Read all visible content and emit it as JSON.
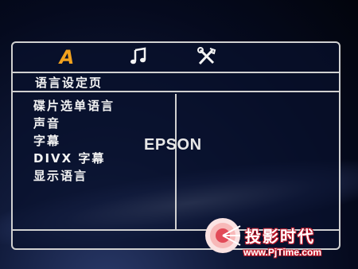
{
  "tabs": [
    {
      "label": "A",
      "icon": "language-icon"
    },
    {
      "icon": "music-note-icon"
    },
    {
      "icon": "tools-icon"
    }
  ],
  "page_title": "语言设定页",
  "menu": {
    "items": [
      {
        "label": "碟片选单语言"
      },
      {
        "label": "声音"
      },
      {
        "label": "字幕"
      },
      {
        "label": "DIVX 字幕"
      },
      {
        "label": "显示语言"
      }
    ]
  },
  "brand": "EPSON",
  "watermark": {
    "name": "投影时代",
    "url": "www.PjTime.com"
  },
  "colors": {
    "accent": "#f2a21e",
    "border": "#d0d0d0",
    "text": "#f4f4f4",
    "watermark_red": "#c0182a"
  }
}
